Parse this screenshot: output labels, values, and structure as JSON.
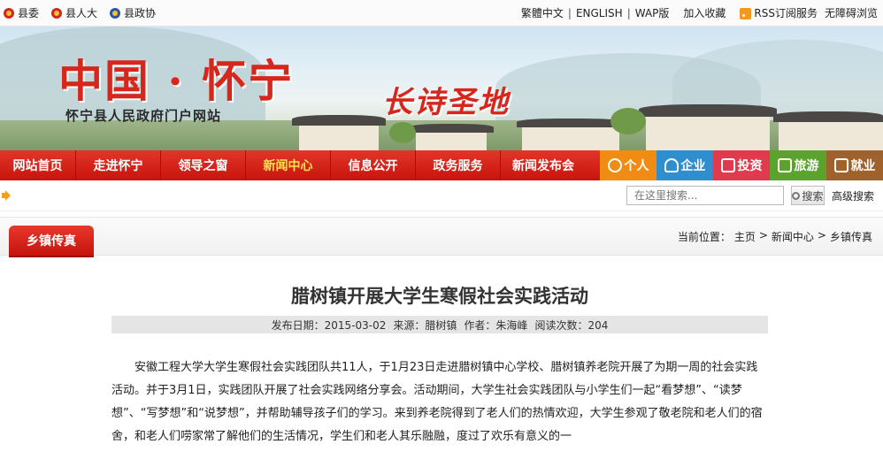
{
  "topbar": {
    "left_links": [
      {
        "label": "县委",
        "icon": "party-emblem-icon"
      },
      {
        "label": "县人大",
        "icon": "national-emblem-icon"
      },
      {
        "label": "县政协",
        "icon": "cppcc-emblem-icon"
      }
    ],
    "lang_traditional": "繁體中文",
    "lang_english": "ENGLISH",
    "wap": "WAP版",
    "favorite": "加入收藏",
    "rss": "RSS订阅服务",
    "accessible": "无障碍浏览"
  },
  "banner": {
    "title": "中国 · 怀宁",
    "subtitle": "怀宁县人民政府门户网站",
    "slogan": "长诗圣地"
  },
  "nav": {
    "items": [
      {
        "label": "网站首页"
      },
      {
        "label": "走进怀宁"
      },
      {
        "label": "领导之窗"
      },
      {
        "label": "新闻中心",
        "active": true
      },
      {
        "label": "信息公开"
      },
      {
        "label": "政务服务"
      },
      {
        "label": "新闻发布会"
      }
    ],
    "quick": [
      {
        "label": "个人",
        "color": "#f08c14",
        "icon": "person-icon"
      },
      {
        "label": "企业",
        "color": "#2f8fce",
        "icon": "group-icon"
      },
      {
        "label": "投资",
        "color": "#e03a4e",
        "icon": "edit-icon"
      },
      {
        "label": "旅游",
        "color": "#5aa32c",
        "icon": "image-icon"
      },
      {
        "label": "就业",
        "color": "#a0622a",
        "icon": "briefcase-icon"
      }
    ]
  },
  "search": {
    "placeholder": "在这里搜索...",
    "button": "搜索",
    "advanced": "高级搜索"
  },
  "section": {
    "tab": "乡镇传真",
    "breadcrumb_prefix": "当前位置：",
    "crumbs": [
      "主页",
      "新闻中心",
      "乡镇传真"
    ],
    "crumb_sep": ">"
  },
  "article": {
    "title": "腊树镇开展大学生寒假社会实践活动",
    "meta_date": "发布日期：2015-03-02",
    "meta_source": "来源：腊树镇",
    "meta_author": "作者：朱海峰",
    "meta_views": "阅读次数：204",
    "body": "安徽工程大学大学生寒假社会实践团队共11人，于1月23日走进腊树镇中心学校、腊树镇养老院开展了为期一周的社会实践活动。并于3月1日，实践团队开展了社会实践网络分享会。活动期间，大学生社会实践团队与小学生们一起“看梦想”、“读梦想”、“写梦想”和“说梦想”，并帮助辅导孩子们的学习。来到养老院得到了老人们的热情欢迎，大学生参观了敬老院和老人们的宿舍，和老人们唠家常了解他们的生活情况，学生们和老人其乐融融，度过了欢乐有意义的一"
  },
  "colors": {
    "brand_red": "#d7261b",
    "nav_red": "#c8140c",
    "active_nav": "#ffe14a"
  }
}
